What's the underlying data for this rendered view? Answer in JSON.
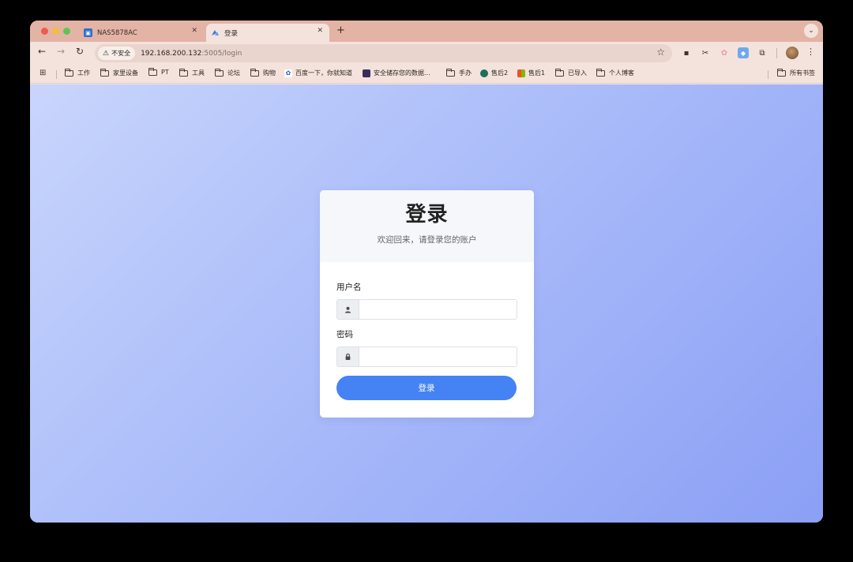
{
  "browser": {
    "tabs": [
      {
        "title": "NAS5878AC",
        "icon": "nas-icon"
      },
      {
        "title": "登录",
        "icon": "login-icon"
      }
    ],
    "new_tab": "+",
    "security_chip": "不安全",
    "url_host": "192.168.200.132",
    "url_path": ":5005/login",
    "bookmarks": [
      {
        "label": "工作",
        "type": "folder"
      },
      {
        "label": "家里设备",
        "type": "folder"
      },
      {
        "label": "PT",
        "type": "folder"
      },
      {
        "label": "工具",
        "type": "folder"
      },
      {
        "label": "论坛",
        "type": "folder"
      },
      {
        "label": "购物",
        "type": "folder"
      },
      {
        "label": "百度一下，你就知道",
        "type": "site"
      },
      {
        "label": "安全储存您的数据...",
        "type": "site"
      },
      {
        "label": "手办",
        "type": "folder"
      },
      {
        "label": "售后2",
        "type": "site"
      },
      {
        "label": "售后1",
        "type": "site"
      },
      {
        "label": "已导入",
        "type": "folder"
      },
      {
        "label": "个人博客",
        "type": "folder"
      }
    ],
    "all_bookmarks": "所有书签"
  },
  "login": {
    "title": "登录",
    "subtitle": "欢迎回来，请登录您的账户",
    "username_label": "用户名",
    "username_value": "",
    "password_label": "密码",
    "password_value": "",
    "submit_label": "登录"
  },
  "colors": {
    "accent": "#4582f3",
    "page_gradient_start": "#c9d5fc",
    "page_gradient_end": "#8b9ff5",
    "tabstrip": "#e3b3a5"
  }
}
